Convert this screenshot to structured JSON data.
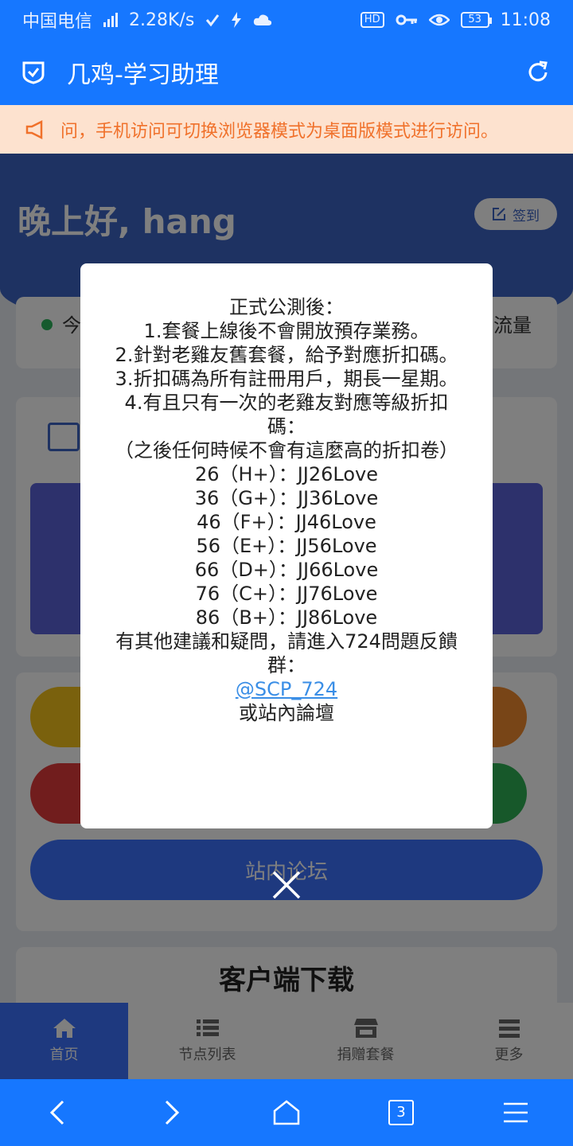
{
  "statusbar": {
    "carrier": "中国电信",
    "network": "4G",
    "speed": "2.28K/s",
    "hd": "HD",
    "battery": "53",
    "time": "11:08"
  },
  "appbar": {
    "title": "几鸡-学习助理"
  },
  "notice": {
    "text": "问，手机访问可切换浏览器模式为桌面版模式进行访问。"
  },
  "page": {
    "greeting": "晚上好, hang",
    "signin_label": "签到",
    "today_label": "今",
    "flow_label": "流量",
    "forum_label": "站内论坛",
    "download_title": "客户端下载"
  },
  "modal": {
    "lines": [
      "正式公測後：",
      "1.套餐上線後不會開放預存業務。",
      "2.針對老雞友舊套餐，給予對應折扣碼。",
      "3.折扣碼為所有註冊用戶，期長一星期。",
      "4.有且只有一次的老雞友對應等級折扣碼：",
      "（之後任何時候不會有這麼高的折扣卷）",
      "26（H+）：JJ26Love",
      "36（G+）：JJ36Love",
      "46（F+）：JJ46Love",
      "56（E+）：JJ56Love",
      "66（D+）：JJ66Love",
      "76（C+）：JJ76Love",
      "86（B+）：JJ86Love",
      "有其他建議和疑問，請進入724問題反饋群："
    ],
    "link": "@SCP_724",
    "footer": "或站內論壇"
  },
  "tabbar": {
    "items": [
      {
        "label": "首页",
        "icon": "home-icon"
      },
      {
        "label": "节点列表",
        "icon": "list-icon"
      },
      {
        "label": "捐赠套餐",
        "icon": "store-icon"
      },
      {
        "label": "更多",
        "icon": "more-icon"
      }
    ]
  },
  "navbar": {
    "tab_count": "3"
  },
  "colors": {
    "primary": "#1677ff",
    "notice_bg": "#fde2cf",
    "notice_text": "#f0712b",
    "link": "#3a8ee6"
  }
}
